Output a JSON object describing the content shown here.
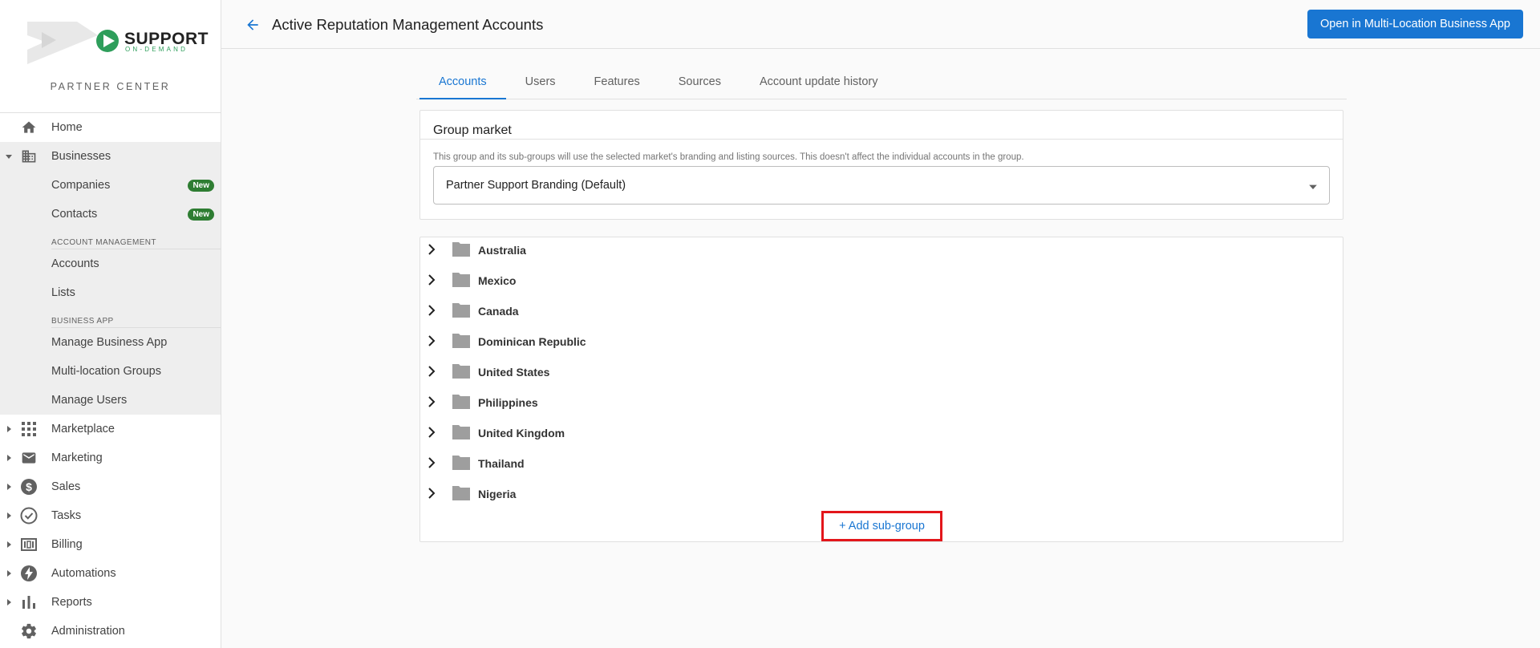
{
  "brand": {
    "name": "SUPPORT",
    "tagline": "ON-DEMAND",
    "center_label": "PARTNER CENTER"
  },
  "sidebar": {
    "items": [
      {
        "label": "Home",
        "icon": "home-icon"
      },
      {
        "label": "Businesses",
        "icon": "business-icon",
        "expanded": true
      },
      {
        "label": "Marketplace",
        "icon": "apps-grid-icon"
      },
      {
        "label": "Marketing",
        "icon": "mail-icon"
      },
      {
        "label": "Sales",
        "icon": "dollar-icon"
      },
      {
        "label": "Tasks",
        "icon": "check-circle-icon"
      },
      {
        "label": "Billing",
        "icon": "billing-icon"
      },
      {
        "label": "Automations",
        "icon": "bolt-icon"
      },
      {
        "label": "Reports",
        "icon": "bar-chart-icon"
      },
      {
        "label": "Administration",
        "icon": "gear-icon"
      }
    ],
    "businesses_sub": {
      "companies": {
        "label": "Companies",
        "badge": "New"
      },
      "contacts": {
        "label": "Contacts",
        "badge": "New"
      },
      "section_account": "ACCOUNT MANAGEMENT",
      "accounts": "Accounts",
      "lists": "Lists",
      "section_business_app": "BUSINESS APP",
      "manage_business_app": "Manage Business App",
      "multi_location_groups": "Multi-location Groups",
      "manage_users": "Manage Users"
    }
  },
  "header": {
    "title": "Active Reputation Management Accounts",
    "open_button": "Open in Multi-Location Business App"
  },
  "tabs": [
    "Accounts",
    "Users",
    "Features",
    "Sources",
    "Account update history"
  ],
  "active_tab": "Accounts",
  "market": {
    "heading": "Group market",
    "description": "This group and its sub-groups will use the selected market's branding and listing sources. This doesn't affect the individual accounts in the group.",
    "selected": "Partner Support Branding (Default)"
  },
  "groups": [
    "Australia",
    "Mexico",
    "Canada",
    "Dominican Republic",
    "United States",
    "Philippines",
    "United Kingdom",
    "Thailand",
    "Nigeria"
  ],
  "add_subgroup_label": "+ Add sub-group",
  "colors": {
    "accent": "#1976d2",
    "badge_green": "#2e7d32",
    "highlight_red": "#e3161b",
    "sidebar_group_bg": "#eeeeee"
  }
}
